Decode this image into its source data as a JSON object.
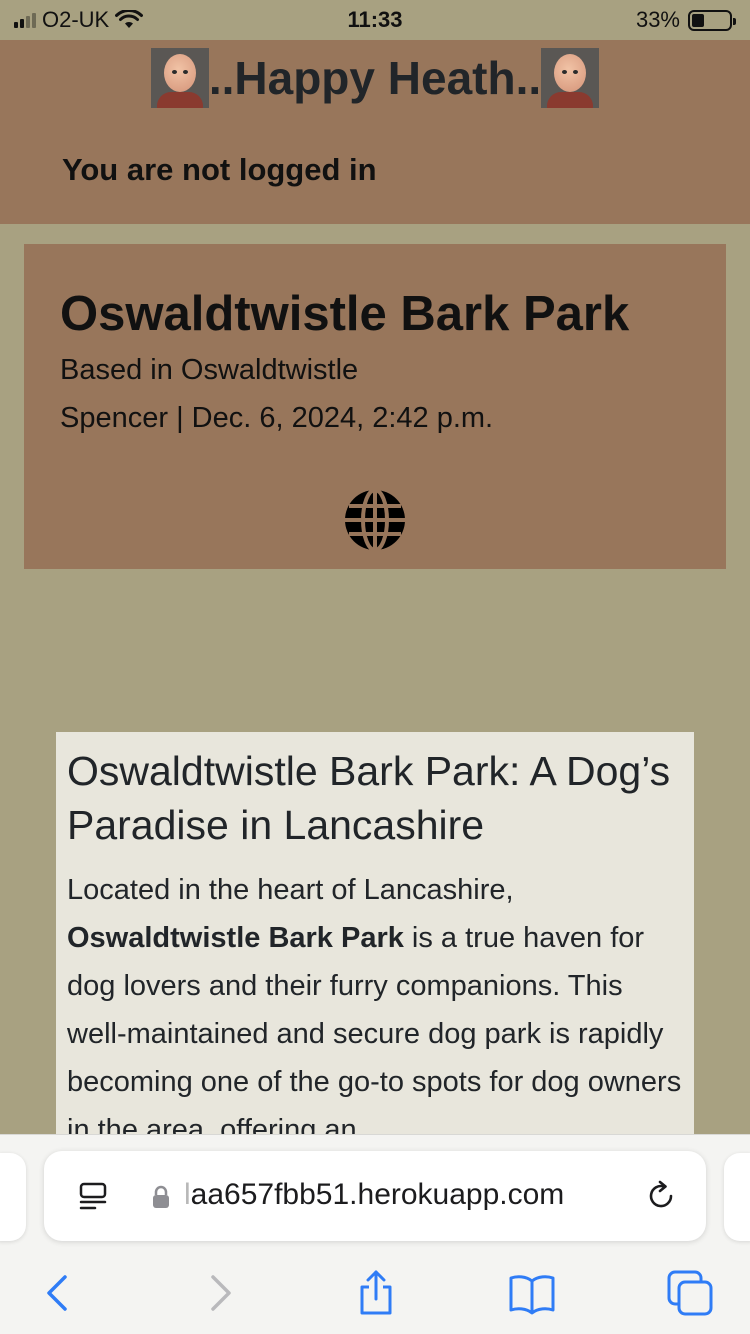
{
  "status_bar": {
    "carrier": "O2-UK",
    "time": "11:33",
    "battery_percent": "33%",
    "battery_level": 0.33,
    "icons": [
      "signal-icon",
      "wifi-icon",
      "battery-icon"
    ]
  },
  "header": {
    "brand": "..Happy Heath..",
    "login_status": "You are not logged in",
    "icons": [
      "avatar-icon"
    ]
  },
  "hero": {
    "title": "Oswaldtwistle Bark Park",
    "location": "Based in Oswaldtwistle",
    "meta": "Spencer | Dec. 6, 2024, 2:42 p.m.",
    "icon": "globe-icon"
  },
  "article": {
    "heading": "Oswaldtwistle Bark Park: A Dog’s Paradise in Lancashire",
    "para_intro": "Located in the heart of Lancashire,",
    "para_bold": "Oswaldtwistle Bark Park",
    "para_rest": " is a true haven for dog lovers and their furry companions. This well-maintained and secure dog park is rapidly becoming one of the go-to spots for dog owners in the area, offering an"
  },
  "browser": {
    "url_faded": "l",
    "url": "aa657fbb51.herokuapp.com",
    "icons": [
      "reader-mode-icon",
      "lock-icon",
      "reload-icon",
      "back-icon",
      "forward-icon",
      "share-icon",
      "bookmarks-icon",
      "tabs-icon"
    ]
  },
  "colors": {
    "page_background": "#a8a181",
    "header_background": "#98765b",
    "article_background": "#e8e6dc",
    "toolbar_accent": "#2f7cf6"
  }
}
